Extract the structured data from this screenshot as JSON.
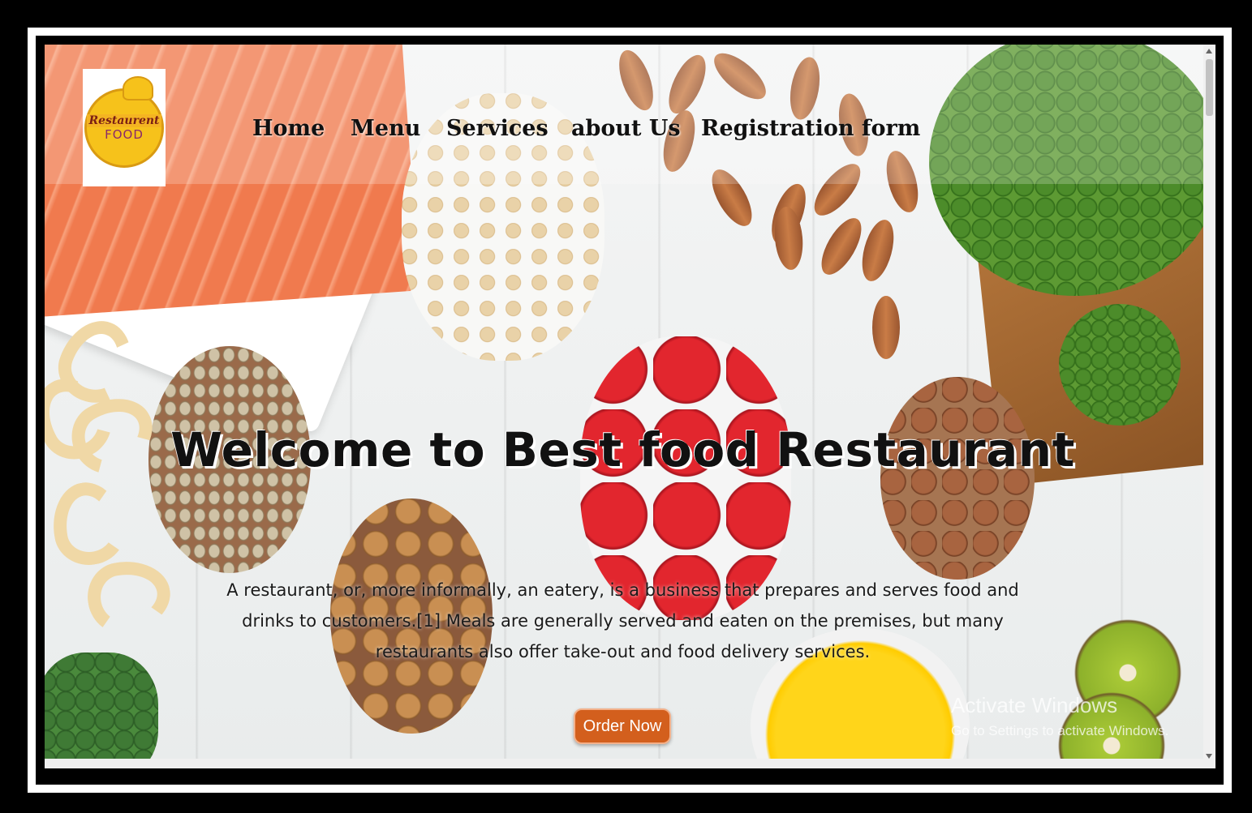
{
  "logo": {
    "line1": "Restaurent",
    "line2": "FOOD"
  },
  "nav": {
    "items": [
      {
        "label": "Home"
      },
      {
        "label": "Menu"
      },
      {
        "label": "Services"
      },
      {
        "label": "about Us"
      },
      {
        "label": "Registration form"
      }
    ]
  },
  "hero": {
    "headline": "Welcome to Best food Restaurant",
    "description": "A restaurant, or, more informally, an eatery, is a business that prepares and serves food and drinks to customers.[1] Meals are generally served and eaten on the premises, but many restaurants also offer take-out and food delivery services.",
    "cta_label": "Order Now"
  },
  "watermark": {
    "line1": "Activate Windows",
    "line2": "Go to Settings to activate Windows."
  },
  "colors": {
    "cta_bg": "#d35f1d",
    "frame_outer": "#000000",
    "frame_inner": "#ffffff"
  }
}
